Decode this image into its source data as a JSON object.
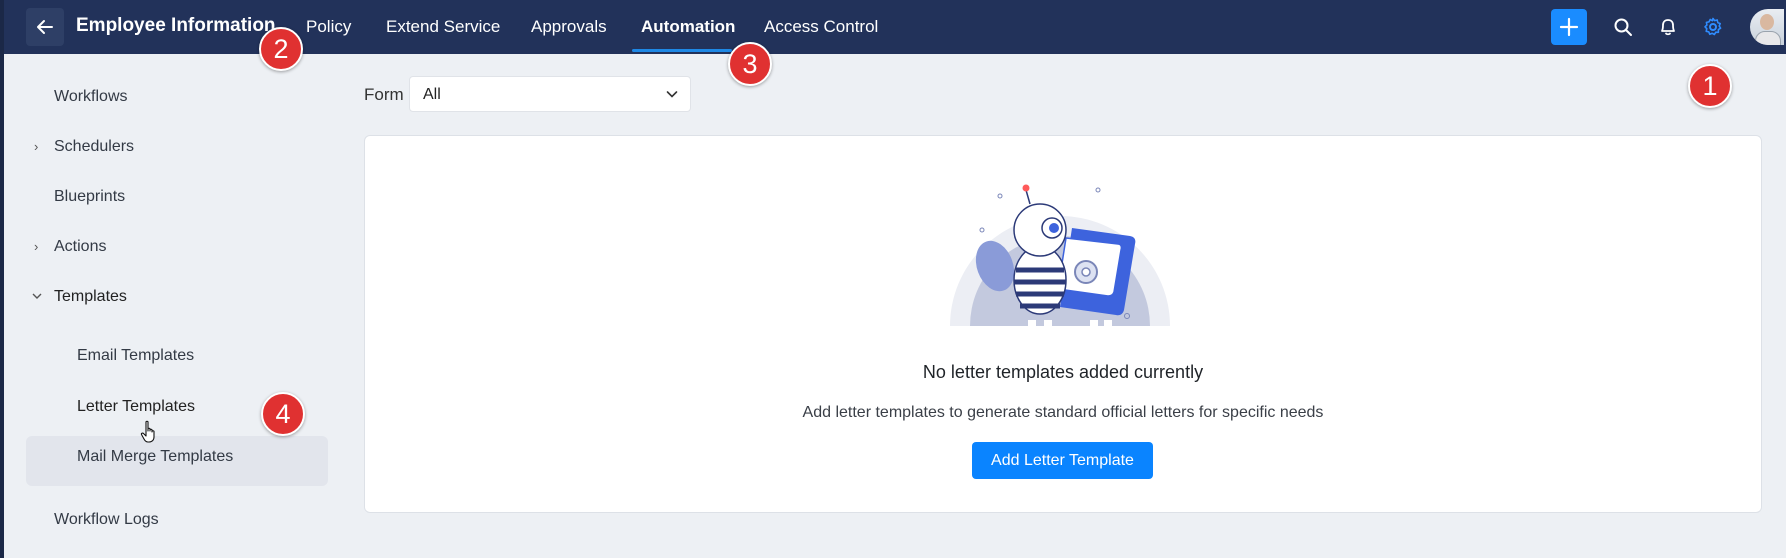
{
  "header": {
    "title": "Employee Information",
    "nav": [
      "Policy",
      "Extend Service",
      "Approvals",
      "Automation",
      "Access Control"
    ],
    "active_nav": "Automation",
    "icons": [
      "back-arrow-icon",
      "plus-icon",
      "search-icon",
      "bell-icon",
      "gear-icon",
      "avatar"
    ]
  },
  "badges": [
    "1",
    "2",
    "3",
    "4"
  ],
  "sidebar": {
    "items": [
      {
        "label": "Workflows"
      },
      {
        "label": "Schedulers"
      },
      {
        "label": "Blueprints"
      },
      {
        "label": "Actions"
      },
      {
        "label": "Templates"
      },
      {
        "label": "Email Templates"
      },
      {
        "label": "Letter Templates"
      },
      {
        "label": "Mail Merge Templates"
      },
      {
        "label": "Workflow Logs"
      }
    ],
    "selected": "Letter Templates"
  },
  "filter": {
    "label": "Form",
    "value": "All"
  },
  "empty_state": {
    "title": "No letter templates added currently",
    "description": "Add letter templates to generate standard official letters for specific needs",
    "button": "Add Letter Template"
  },
  "colors": {
    "topbar": "#22325a",
    "accent": "#0a84ff",
    "badge": "#e03131",
    "gear_active": "#2f8cff"
  }
}
